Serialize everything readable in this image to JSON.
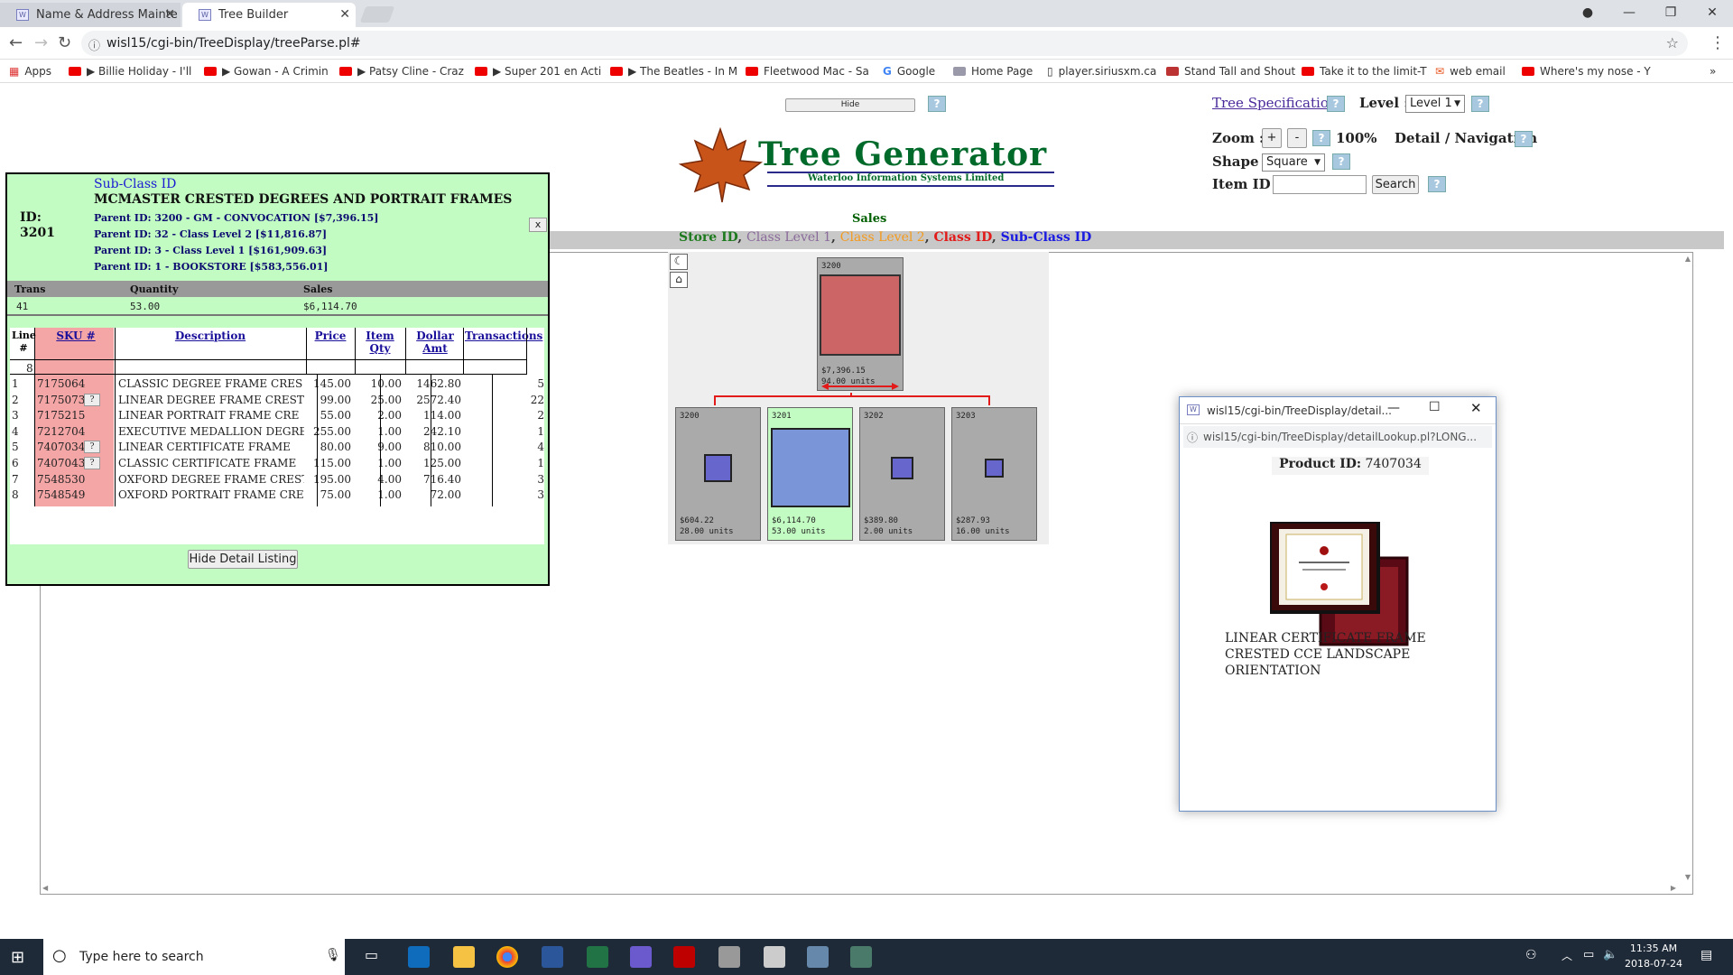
{
  "browser": {
    "tabs": [
      {
        "title": "Name & Address Mainte",
        "active": false
      },
      {
        "title": "Tree Builder",
        "active": true
      }
    ],
    "url": "wisl15/cgi-bin/TreeDisplay/treeParse.pl#",
    "bookmarks": [
      "Apps",
      "Billie Holiday - I'll",
      "Gowan - A Crimin",
      "Patsy Cline - Craz",
      "Super 201 en Acti",
      "The Beatles - In M",
      "Fleetwood Mac - Sa",
      "Google",
      "Home Page",
      "player.siriusxm.ca",
      "Stand Tall and Shout",
      "Take it to the limit-T",
      "web email",
      "Where's my nose - Y"
    ]
  },
  "toolbar": {
    "hide_label": "Hide",
    "help_label": "?",
    "tree_spec_link": "Tree Specifications",
    "level_label": "Level :",
    "level_value": "Level 1",
    "zoom_label": "Zoom :",
    "zoom_plus": "+",
    "zoom_minus": "-",
    "zoom_value": "100%",
    "detail_nav_label": "Detail / Navigation",
    "shape_label": "Shape :",
    "shape_value": "Square",
    "item_id_label": "Item ID :",
    "item_id_value": "",
    "search_label": "Search"
  },
  "logo": {
    "title": "Tree Generator",
    "subtitle": "Waterloo Information Systems Limited"
  },
  "sales_label": "Sales",
  "levels": [
    {
      "text": "Store ID",
      "color": "#1e7a1e"
    },
    {
      "text": "Class Level 1",
      "color": "#8a6a9a"
    },
    {
      "text": "Class Level 2",
      "color": "#f59a1a"
    },
    {
      "text": "Class ID",
      "color": "#e21a1a"
    },
    {
      "text": "Sub-Class ID",
      "color": "#1a1ae2"
    }
  ],
  "tree": {
    "root": {
      "id": "3200",
      "sales": "$7,396.15",
      "units": "94.00 units",
      "fill_color": "#cc6666"
    },
    "children": [
      {
        "id": "3200",
        "sales": "$604.22",
        "units": "28.00 units",
        "size": 0.35,
        "selected": false
      },
      {
        "id": "3201",
        "sales": "$6,114.70",
        "units": "53.00 units",
        "size": 1.0,
        "selected": true
      },
      {
        "id": "3202",
        "sales": "$389.80",
        "units": "2.00 units",
        "size": 0.28,
        "selected": false
      },
      {
        "id": "3203",
        "sales": "$287.93",
        "units": "16.00 units",
        "size": 0.24,
        "selected": false
      }
    ]
  },
  "detail": {
    "subclass_label": "Sub-Class ID",
    "title": "MCMASTER CRESTED DEGREES AND PORTRAIT FRAMES",
    "id_label": "ID:",
    "id_value": "3201",
    "close_label": "x",
    "parents": [
      "Parent ID: 3200 - GM - CONVOCATION [$7,396.15]",
      "Parent ID: 32 - Class Level 2 [$11,816.87]",
      "Parent ID: 3 - Class Level 1 [$161,909.63]",
      "Parent ID: 1 - BOOKSTORE [$583,556.01]"
    ],
    "summary_headers": [
      "Trans",
      "Quantity",
      "Sales"
    ],
    "summary_values": [
      "41",
      "53.00",
      "$6,114.70"
    ],
    "columns": [
      "Line #",
      "SKU #",
      "Description",
      "Price",
      "Item Qty",
      "Dollar Amt",
      "Transactions"
    ],
    "line_count": "8",
    "rows": [
      {
        "line": "1",
        "sku": "7175064",
        "q": false,
        "desc": "CLASSIC DEGREE FRAME CRES",
        "price": "145.00",
        "qty": "10.00",
        "amt": "1462.80",
        "trans": "5"
      },
      {
        "line": "2",
        "sku": "7175073",
        "q": true,
        "desc": "LINEAR DEGREE FRAME CREST",
        "price": "99.00",
        "qty": "25.00",
        "amt": "2572.40",
        "trans": "22"
      },
      {
        "line": "3",
        "sku": "7175215",
        "q": false,
        "desc": "LINEAR PORTRAIT FRAME CRE",
        "price": "55.00",
        "qty": "2.00",
        "amt": "114.00",
        "trans": "2"
      },
      {
        "line": "4",
        "sku": "7212704",
        "q": false,
        "desc": "EXECUTIVE MEDALLION DEGRE",
        "price": "255.00",
        "qty": "1.00",
        "amt": "242.10",
        "trans": "1"
      },
      {
        "line": "5",
        "sku": "7407034",
        "q": true,
        "desc": "LINEAR CERTIFICATE FRAME",
        "price": "80.00",
        "qty": "9.00",
        "amt": "810.00",
        "trans": "4"
      },
      {
        "line": "6",
        "sku": "7407043",
        "q": true,
        "desc": "CLASSIC CERTIFICATE FRAME",
        "price": "115.00",
        "qty": "1.00",
        "amt": "125.00",
        "trans": "1"
      },
      {
        "line": "7",
        "sku": "7548530",
        "q": false,
        "desc": "OXFORD DEGREE FRAME CREST",
        "price": "195.00",
        "qty": "4.00",
        "amt": "716.40",
        "trans": "3"
      },
      {
        "line": "8",
        "sku": "7548549",
        "q": false,
        "desc": "OXFORD PORTRAIT FRAME CRE",
        "price": "75.00",
        "qty": "1.00",
        "amt": "72.00",
        "trans": "3"
      }
    ],
    "question_label": "?",
    "hide_button": "Hide Detail Listing"
  },
  "popup": {
    "title": "wisl15/cgi-bin/TreeDisplay/detail...",
    "url": "wisl15/cgi-bin/TreeDisplay/detailLookup.pl?LONG...",
    "product_label": "Product ID:",
    "product_id": "7407034",
    "description": "LINEAR CERTIFICATE FRAME CRESTED CCE LANDSCAPE ORIENTATION"
  },
  "taskbar": {
    "search_placeholder": "Type here to search",
    "time": "11:35 AM",
    "date": "2018-07-24"
  }
}
